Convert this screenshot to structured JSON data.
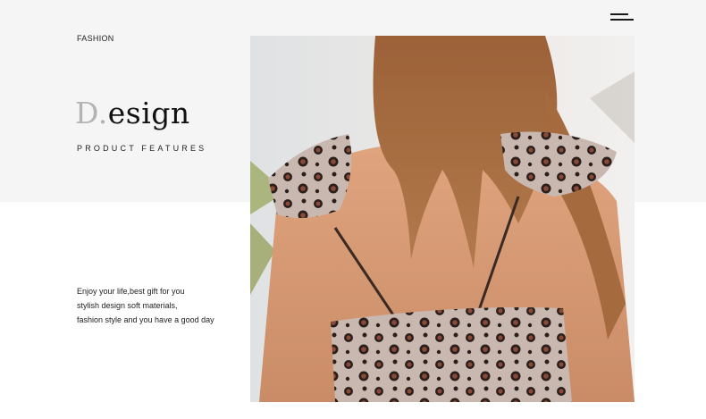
{
  "header": {
    "section_label": "FASHION",
    "menu_icon": "menu-icon"
  },
  "hero": {
    "title_initial": "D.",
    "title_rest": "esign",
    "subtitle": "PRODUCT FEATURES"
  },
  "description": {
    "lines": [
      "Enjoy your life,best gift for you",
      "stylish design soft materials,",
      "fashion style and you have a good day"
    ]
  },
  "photo": {
    "subject": "leopard-print-swimsuit-back-photo"
  },
  "colors": {
    "top_band": "#f5f5f5",
    "title_initial": "#b3b3b3",
    "text": "#222222"
  }
}
